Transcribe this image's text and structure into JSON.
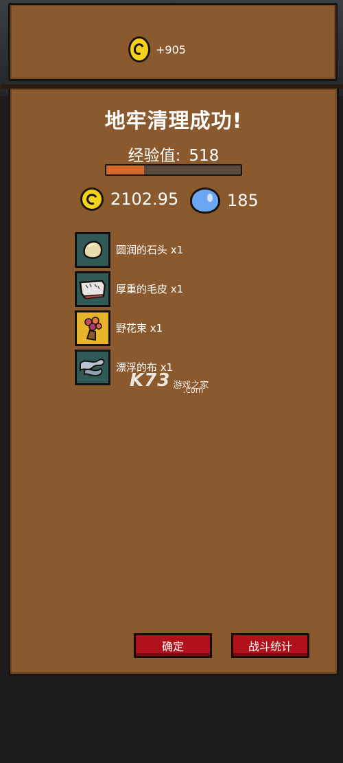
{
  "top": {
    "gold_gain": "+905"
  },
  "result": {
    "title": "地牢清理成功!",
    "exp_label": "经验值:",
    "exp_value": "518",
    "exp_progress": 0.28,
    "gold": "2102.95",
    "gems": "185"
  },
  "items": [
    {
      "label": "圆润的石头 x1",
      "icon": "round-stone-icon"
    },
    {
      "label": "厚重的毛皮 x1",
      "icon": "heavy-fur-icon"
    },
    {
      "label": "野花束 x1",
      "icon": "flower-bouquet-icon"
    },
    {
      "label": "漂浮的布 x1",
      "icon": "floating-cloth-icon"
    }
  ],
  "buttons": {
    "confirm": "确定",
    "stats": "战斗统计"
  },
  "watermark": {
    "logo": "K73",
    "cn": "游戏之家",
    "domain": ".com"
  },
  "colors": {
    "panel": "#8a5a2e",
    "button": "#b0111a",
    "exp_fill": "#d46a2a",
    "coin": "#f6d21c",
    "gem": "#6aa6f2"
  }
}
